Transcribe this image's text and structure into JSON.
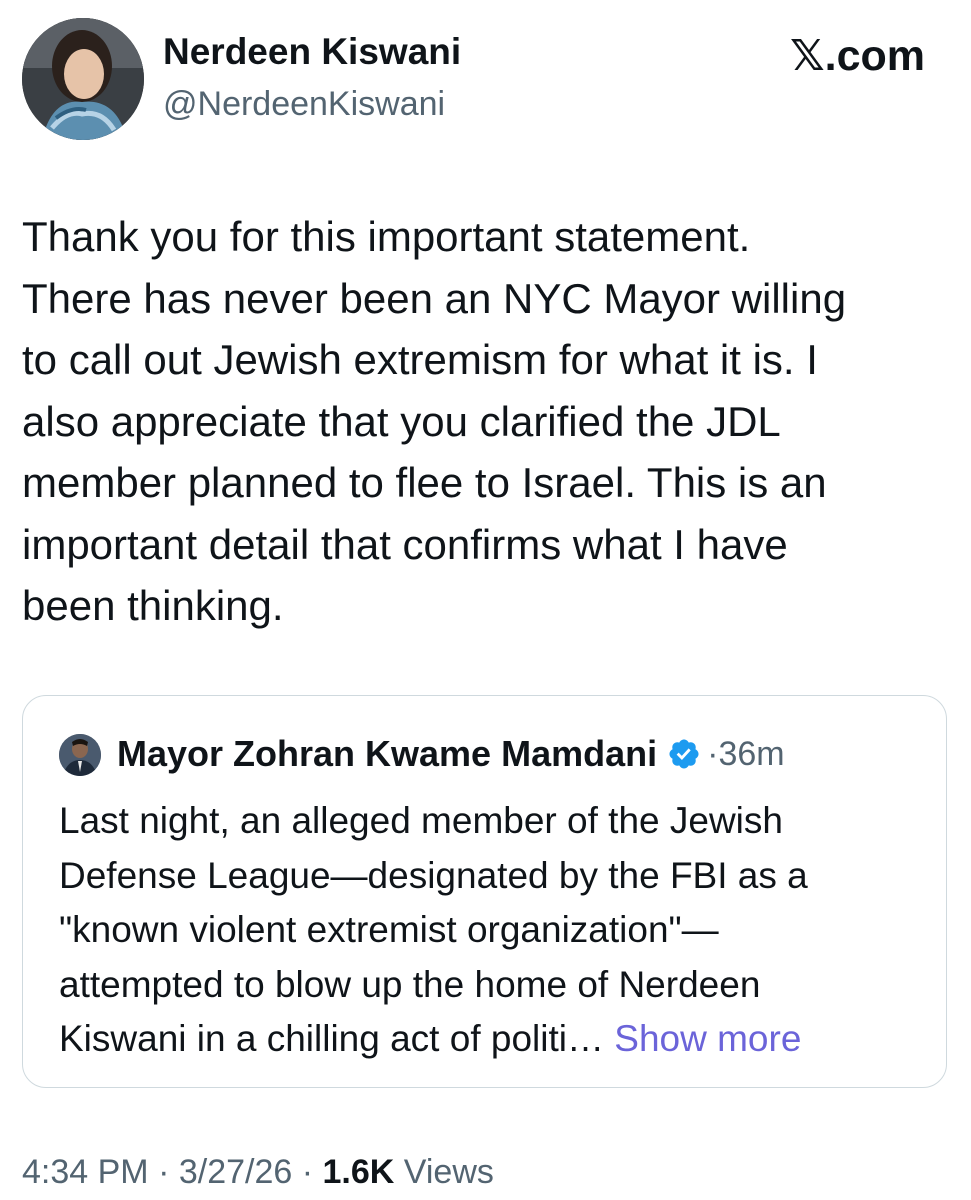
{
  "author": {
    "name": "Nerdeen Kiswani",
    "handle": "@NerdeenKiswani"
  },
  "brand": {
    "x_glyph": "𝕏",
    "domain_suffix": ".com"
  },
  "tweet": {
    "text": "Thank you for this important statement.\nThere has never been an NYC Mayor willing\nto call out Jewish extremism for what it is. I\nalso appreciate that you clarified the JDL\nmember planned to flee to Israel. This is an\nimportant detail that confirms what I have\nbeen thinking."
  },
  "quoted_tweet": {
    "author_name": "Mayor Zohran Kwame Mamdani",
    "verified_icon": "verified-badge-icon",
    "verified_color": "#1d9bf0",
    "separator": "·",
    "time_ago": "36m",
    "text": "Last night, an alleged member of the Jewish\nDefense League—designated by the FBI as a\n\"known violent extremist organization\"—\nattempted to blow up the home of Nerdeen\nKiswani in a chilling act of politi…",
    "show_more_label": " Show more",
    "show_more_color": "#6b64d9"
  },
  "meta": {
    "time": "4:34 PM",
    "sep1": " · ",
    "date": "3/27/26",
    "sep2": " · ",
    "views_count": "1.6K",
    "views_label": " Views"
  }
}
